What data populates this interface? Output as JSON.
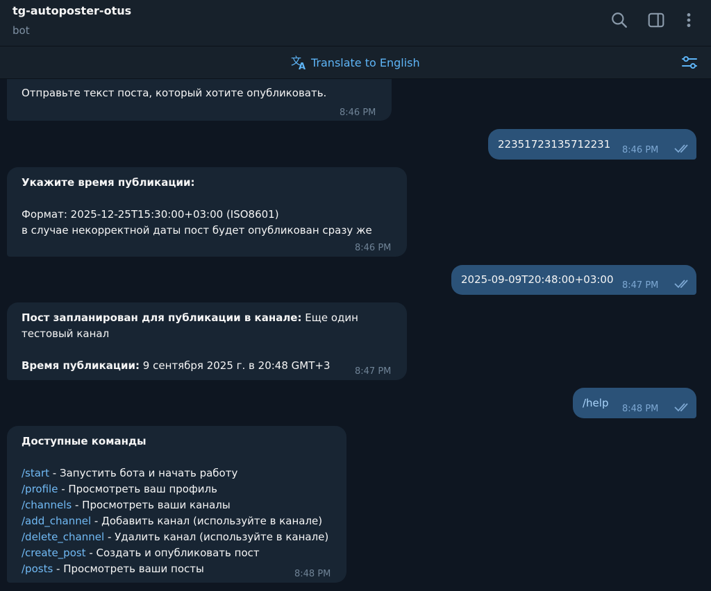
{
  "header": {
    "title": "tg-autoposter-otus",
    "subtitle": "bot",
    "icons": [
      "search-icon",
      "sidebar-toggle-icon",
      "more-vert-icon"
    ]
  },
  "translate_bar": {
    "label": "Translate to English",
    "icons": [
      "translate-icon",
      "translate-settings-icon"
    ]
  },
  "messages": {
    "m1": {
      "text": "Отправьте текст поста, который хотите опубликовать.",
      "time": "8:46 PM"
    },
    "m2": {
      "text": "22351723135712231",
      "time": "8:46 PM"
    },
    "m3": {
      "heading": "Укажите время публикации:",
      "line1": "Формат: 2025-12-25T15:30:00+03:00 (ISO8601)",
      "line2": "в случае некорректной даты пост будет опубликован сразу же",
      "time": "8:46 PM"
    },
    "m4": {
      "text": "2025-09-09T20:48:00+03:00",
      "time": "8:47 PM"
    },
    "m5": {
      "bold1": "Пост запланирован для публикации в канале:",
      "text1": " Еще один",
      "text1b": "тестовый канал",
      "bold2": "Время публикации:",
      "text2": " 9 сентября 2025 г. в 20:48 GMT+3",
      "time": "8:47 PM"
    },
    "m6": {
      "text": "/help",
      "time": "8:48 PM"
    },
    "m7": {
      "heading": "Доступные команды",
      "commands": [
        {
          "cmd": "/start",
          "desc": " - Запустить бота и начать работу"
        },
        {
          "cmd": "/profile",
          "desc": " - Просмотреть ваш профиль"
        },
        {
          "cmd": "/channels",
          "desc": " - Просмотреть ваши каналы"
        },
        {
          "cmd": "/add_channel",
          "desc": " - Добавить канал (используйте в канале)"
        },
        {
          "cmd": "/delete_channel",
          "desc": " - Удалить канал (используйте в канале)"
        },
        {
          "cmd": "/create_post",
          "desc": " - Создать и опубликовать пост"
        },
        {
          "cmd": "/posts",
          "desc": " - Просмотреть ваши посты"
        }
      ],
      "time": "8:48 PM"
    }
  },
  "colors": {
    "background": "#0e1621",
    "header": "#17212b",
    "incoming_bubble": "#182533",
    "outgoing_bubble": "#2b5278",
    "accent": "#5eb5f7",
    "link": "#71baf5"
  }
}
